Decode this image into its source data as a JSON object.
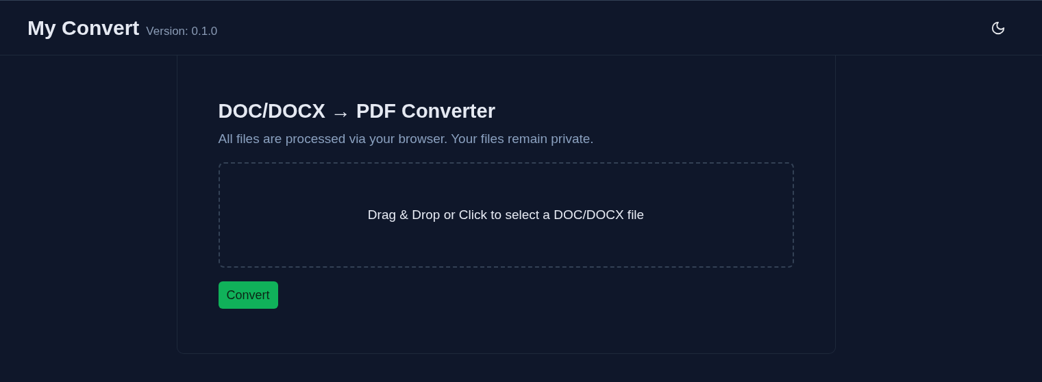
{
  "header": {
    "title": "My Convert",
    "version": "Version: 0.1.0"
  },
  "converter": {
    "title": "DOC/DOCX → PDF Converter",
    "subtitle": "All files are processed via your browser. Your files remain private.",
    "dropzone": {
      "placeholder": "Drag & Drop or Click to select a DOC/DOCX file"
    },
    "button": {
      "label": "Convert",
      "disabled": false
    }
  }
}
